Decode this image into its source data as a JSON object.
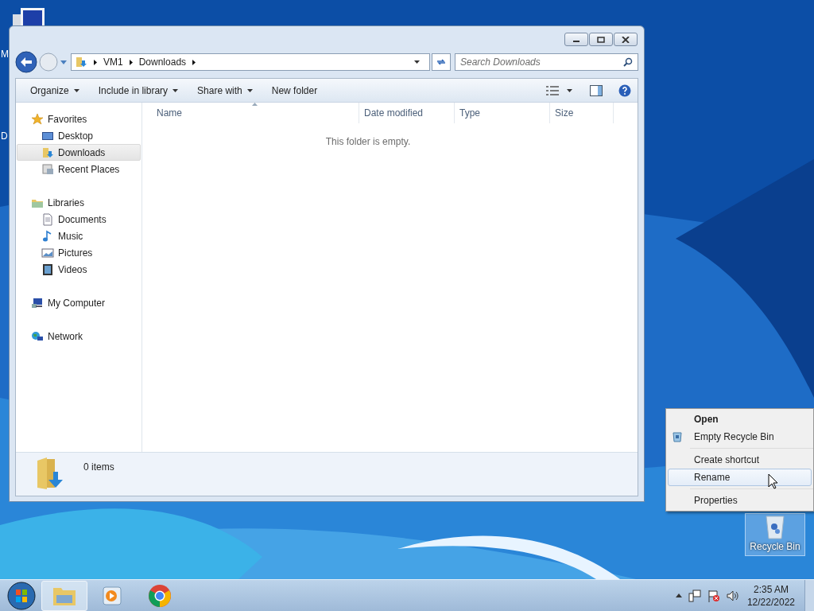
{
  "desktop": {
    "edge_labels": [
      "M",
      "D"
    ],
    "icons": [
      {
        "label": "Recycle Bin",
        "selected": true
      }
    ]
  },
  "window": {
    "address": {
      "crumbs": [
        "VM1",
        "Downloads"
      ]
    },
    "search": {
      "placeholder": "Search Downloads"
    },
    "toolbar": [
      {
        "label": "Organize",
        "dropdown": true
      },
      {
        "label": "Include in library",
        "dropdown": true
      },
      {
        "label": "Share with",
        "dropdown": true
      },
      {
        "label": "New folder",
        "dropdown": false
      }
    ],
    "sidebar": [
      {
        "label": "Favorites",
        "children": [
          {
            "label": "Desktop",
            "selected": false
          },
          {
            "label": "Downloads",
            "selected": true
          },
          {
            "label": "Recent Places",
            "selected": false
          }
        ]
      },
      {
        "label": "Libraries",
        "children": [
          {
            "label": "Documents",
            "selected": false
          },
          {
            "label": "Music",
            "selected": false
          },
          {
            "label": "Pictures",
            "selected": false
          },
          {
            "label": "Videos",
            "selected": false
          }
        ]
      },
      {
        "label": "My Computer"
      },
      {
        "label": "Network"
      }
    ],
    "columns": [
      "Name",
      "Date modified",
      "Type",
      "Size"
    ],
    "empty_message": "This folder is empty.",
    "status": "0 items"
  },
  "context_menu": {
    "groups": [
      [
        {
          "label": "Open",
          "kind": "default",
          "selected": false
        },
        {
          "label": "Empty Recycle Bin",
          "kind": "normal",
          "selected": false
        }
      ],
      [
        {
          "label": "Create shortcut",
          "kind": "normal",
          "selected": false
        },
        {
          "label": "Rename",
          "kind": "normal",
          "selected": true
        }
      ],
      [
        {
          "label": "Properties",
          "kind": "normal",
          "selected": false
        }
      ]
    ]
  },
  "taskbar": {
    "apps": [
      {
        "selected": true
      },
      {
        "selected": false
      },
      {
        "selected": false
      }
    ],
    "time": "2:35 AM",
    "date": "12/22/2022"
  }
}
